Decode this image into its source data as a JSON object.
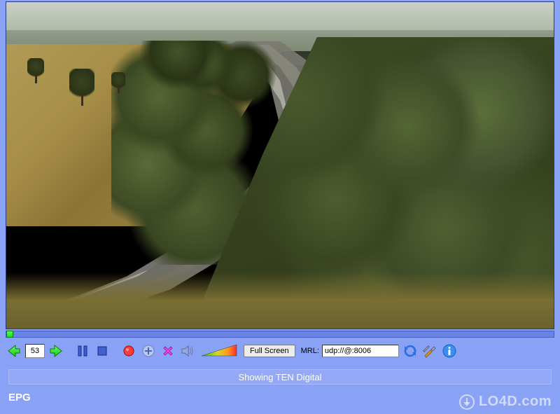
{
  "video": {
    "description": "aerial-road-through-trees"
  },
  "seek": {
    "position_percent": 0
  },
  "toolbar": {
    "channel_value": "53",
    "prev_icon": "arrow-left",
    "next_icon": "arrow-right",
    "pause_icon": "pause",
    "stop_icon": "stop",
    "record_icon": "record",
    "add_icon": "plus",
    "delete_icon": "delete-x",
    "audio_icon": "speaker",
    "fullscreen_label": "Full Screen",
    "mrl_label": "MRL:",
    "mrl_value": "udp://@:8006",
    "refresh_icon": "refresh",
    "settings_icon": "tools",
    "info_icon": "info"
  },
  "status": {
    "text": "Showing TEN Digital"
  },
  "epg": {
    "label": "EPG"
  },
  "watermark": {
    "text": "LO4D.com"
  }
}
